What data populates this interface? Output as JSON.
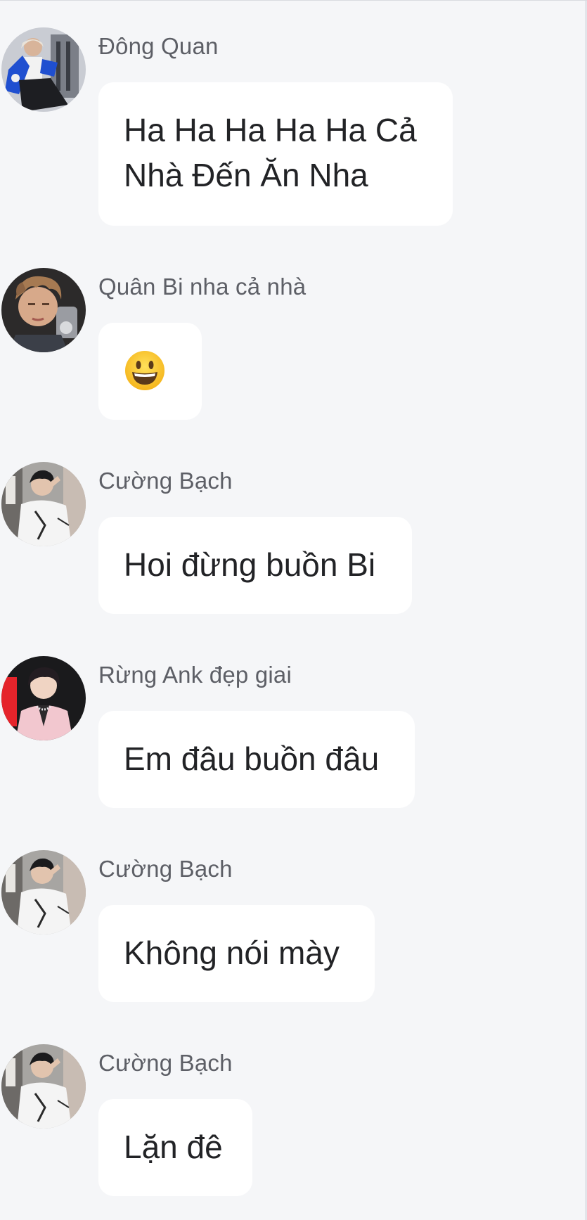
{
  "messages": [
    {
      "sender": "Đông Quan",
      "text": "Ha Ha Ha Ha Ha Cả Nhà Đến Ăn Nha",
      "avatar": "avatar-blue-jacket"
    },
    {
      "sender": "Quân Bi nha cả nhà",
      "text": "",
      "emoji": "grinning-face-emoji",
      "avatar": "avatar-curly-hair"
    },
    {
      "sender": "Cường Bạch",
      "text": "Hoi đừng buồn Bi",
      "avatar": "avatar-white-jacket"
    },
    {
      "sender": "Rừng Ank đẹp giai",
      "text": "Em đâu buồn đâu",
      "avatar": "avatar-pink-suit"
    },
    {
      "sender": "Cường Bạch",
      "text": "Không nói mày",
      "avatar": "avatar-white-jacket"
    },
    {
      "sender": "Cường Bạch",
      "text": "Lặn đê",
      "avatar": "avatar-white-jacket"
    }
  ],
  "colors": {
    "background": "#f5f6f8",
    "bubble": "#ffffff",
    "sender_text": "#5d5f66",
    "message_text": "#222326"
  }
}
